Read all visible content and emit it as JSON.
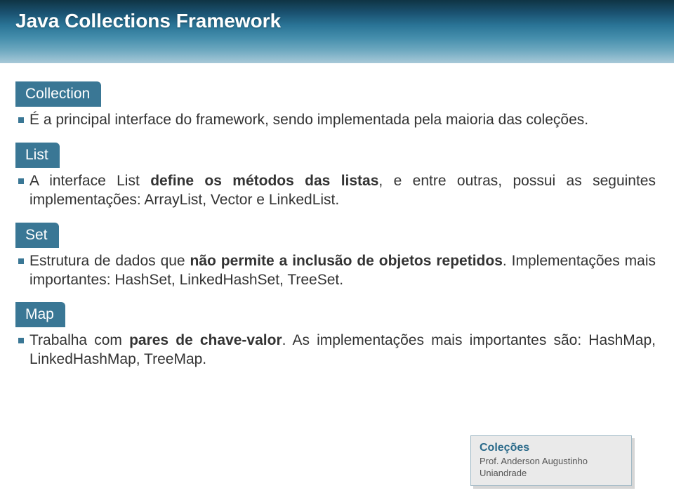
{
  "header": {
    "title": "Java Collections Framework"
  },
  "blocks": [
    {
      "tab": "Collection",
      "desc_parts": [
        {
          "text": "É a principal interface do framework, sendo implementada pela maioria das coleções.",
          "bold": false
        }
      ]
    },
    {
      "tab": "List",
      "desc_parts": [
        {
          "text": "A interface List ",
          "bold": false
        },
        {
          "text": "define os métodos das listas",
          "bold": true
        },
        {
          "text": ", e entre outras, possui as seguintes implementações: ArrayList, Vector e LinkedList.",
          "bold": false
        }
      ]
    },
    {
      "tab": "Set",
      "desc_parts": [
        {
          "text": "Estrutura de dados que ",
          "bold": false
        },
        {
          "text": "não permite a inclusão de objetos repetidos",
          "bold": true
        },
        {
          "text": ". Implementações mais importantes: HashSet, LinkedHashSet, TreeSet.",
          "bold": false
        }
      ]
    },
    {
      "tab": "Map",
      "desc_parts": [
        {
          "text": "Trabalha com ",
          "bold": false
        },
        {
          "text": "pares de chave-valor",
          "bold": true
        },
        {
          "text": ". As implementações mais importantes são: HashMap, LinkedHashMap, TreeMap.",
          "bold": false
        }
      ]
    }
  ],
  "footer": {
    "title": "Coleções",
    "line1": "Prof. Anderson Augustinho",
    "line2": "Uniandrade"
  }
}
